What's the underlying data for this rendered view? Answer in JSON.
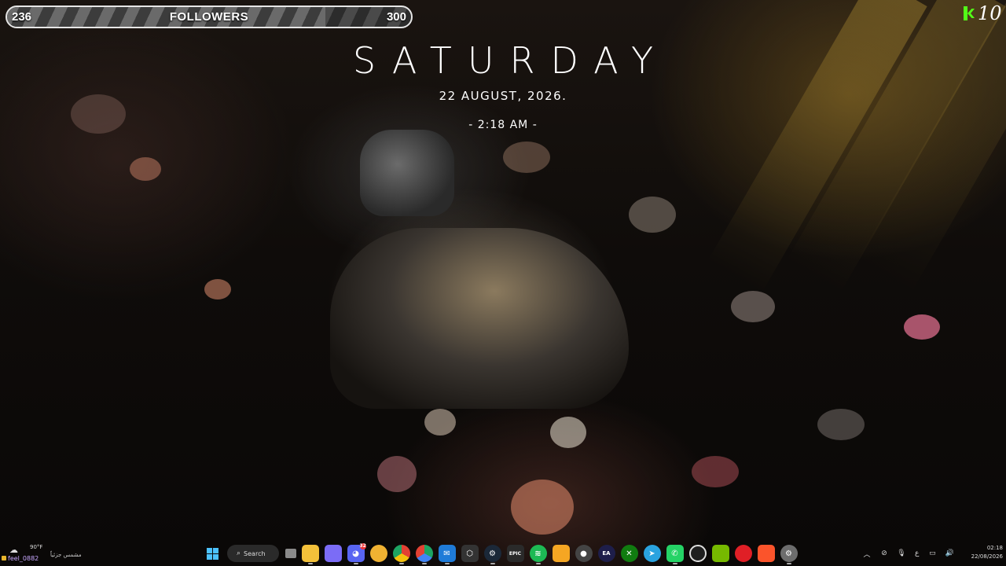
{
  "followers": {
    "current": "236",
    "goal": "300",
    "label": "FOLLOWERS",
    "progress_fraction": 0.787
  },
  "kick": {
    "icon": "kick-logo-icon",
    "count": "10",
    "brand_color": "#53fc18"
  },
  "clock": {
    "day": "SATURDAY",
    "date": "22 AUGUST, 2026.",
    "time": "- 2:18 AM -"
  },
  "taskbar": {
    "weather": {
      "icon": "partly-cloudy-icon",
      "temp": "90°F",
      "condition": "مشمس جزئياً",
      "tag": "feel_0882"
    },
    "search_label": "Search",
    "apps": [
      {
        "name": "start-button",
        "icon": "windows-icon",
        "color": "#4cc2ff"
      },
      {
        "name": "search-button",
        "icon": "search-icon"
      },
      {
        "name": "task-view-button",
        "icon": "task-view-icon",
        "color": "#8a8a8a"
      },
      {
        "name": "file-explorer-app",
        "icon": "folder-icon",
        "color": "#f3c13a"
      },
      {
        "name": "copilot-app",
        "icon": "copilot-icon",
        "color": "#7b6cf6"
      },
      {
        "name": "discord-app",
        "icon": "discord-icon",
        "color": "#5865f2",
        "badge": "32"
      },
      {
        "name": "discord-canary-app",
        "icon": "discord-yellow-icon",
        "color": "#f0b232"
      },
      {
        "name": "chrome-app",
        "icon": "chrome-icon",
        "color": "#e34133"
      },
      {
        "name": "chrome-beta-app",
        "icon": "chrome-beta-icon",
        "color": "#1da462"
      },
      {
        "name": "outlook-app",
        "icon": "mail-icon",
        "color": "#1f7bd8"
      },
      {
        "name": "unity-app",
        "icon": "cube-icon",
        "color": "#333333"
      },
      {
        "name": "steam-app",
        "icon": "steam-icon",
        "color": "#1b2838"
      },
      {
        "name": "epic-games-app",
        "icon": "epic-icon",
        "color": "#2a2a2a",
        "label": "EPIC"
      },
      {
        "name": "spotify-app",
        "icon": "spotify-icon",
        "color": "#1db954"
      },
      {
        "name": "blender-app",
        "icon": "flame-icon",
        "color": "#f5a623"
      },
      {
        "name": "obs-app",
        "icon": "record-icon",
        "color": "#444444"
      },
      {
        "name": "ea-app",
        "icon": "ea-icon",
        "color": "#ff4747",
        "label": "EA"
      },
      {
        "name": "xbox-app",
        "icon": "xbox-icon",
        "color": "#107c10"
      },
      {
        "name": "telegram-app",
        "icon": "telegram-icon",
        "color": "#2aa3e0"
      },
      {
        "name": "whatsapp-app",
        "icon": "whatsapp-icon",
        "color": "#25d366"
      },
      {
        "name": "capcut-app",
        "icon": "capcut-icon",
        "color": "#1f1f1f"
      },
      {
        "name": "nvidia-app",
        "icon": "nvidia-icon",
        "color": "#76b900"
      },
      {
        "name": "adobe-app",
        "icon": "adobe-icon",
        "color": "#e01f26"
      },
      {
        "name": "brave-app",
        "icon": "brave-icon",
        "color": "#fb542b"
      },
      {
        "name": "settings-app",
        "icon": "gear-icon",
        "color": "#6d6d6d"
      }
    ],
    "tray": {
      "chevron_icon": "chevron-up-icon",
      "icons": [
        "mute-notification-icon",
        "microphone-icon"
      ],
      "language": "ع",
      "status_icons": [
        "network-icon",
        "volume-icon"
      ]
    },
    "clock": {
      "time": "02:18",
      "date": "22/08/2026"
    }
  }
}
